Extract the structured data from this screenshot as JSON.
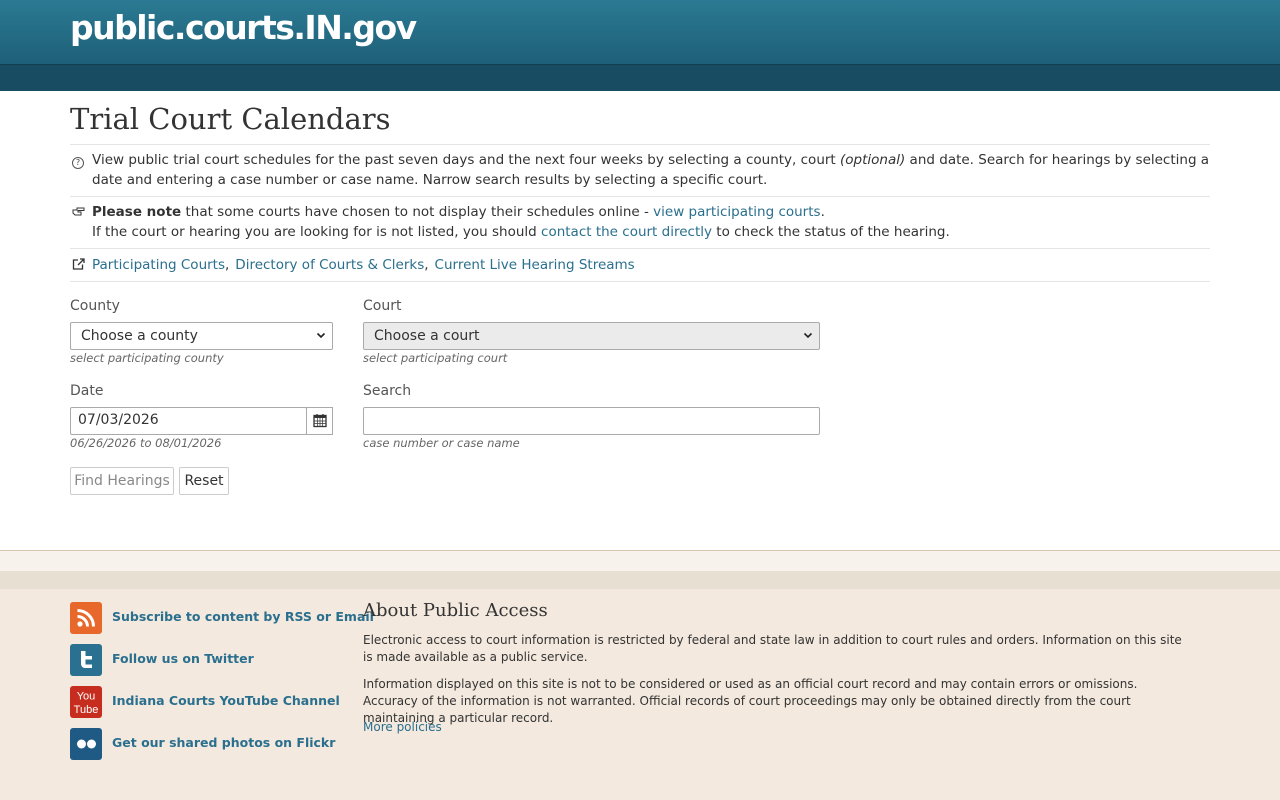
{
  "header": {
    "site_title": "public.courts.IN.gov"
  },
  "page": {
    "title": "Trial Court Calendars"
  },
  "info": {
    "intro_1": "View public trial court schedules for the past seven days and the next four weeks by selecting a county, court ",
    "intro_optional": "(optional)",
    "intro_2": " and date. Search for hearings by selecting a date and entering a case number or case name. Narrow search results by selecting a specific court.",
    "note_bold": "Please note",
    "note_1": " that some courts have chosen to not display their schedules online - ",
    "note_link": "view participating courts",
    "note_end": ".",
    "note_2": "If the court or hearing you are looking for is not listed, you should ",
    "note_link2": "contact the court directly",
    "note_3": " to check the status of the hearing.",
    "links": [
      "Participating Courts",
      "Directory of Courts & Clerks",
      "Current Live Hearing Streams"
    ],
    "link_sep": ","
  },
  "form": {
    "county_label": "County",
    "county_value": "Choose a county",
    "county_hint": "select participating county",
    "court_label": "Court",
    "court_value": "Choose a court",
    "court_hint": "select participating court",
    "date_label": "Date",
    "date_value": "07/03/2026",
    "date_hint": "06/26/2026 to 08/01/2026",
    "search_label": "Search",
    "search_value": "",
    "search_hint": "case number or case name",
    "find_button": "Find Hearings",
    "reset_button": "Reset"
  },
  "footer": {
    "social": [
      {
        "label": "Subscribe to content by RSS or Email",
        "icon": "rss-icon",
        "color": "#e8682c"
      },
      {
        "label": "Follow us on Twitter",
        "icon": "twitter-icon",
        "color": "#2a7090"
      },
      {
        "label": "Indiana Courts YouTube Channel",
        "icon": "youtube-icon",
        "color": "#c62d1f"
      },
      {
        "label": "Get our shared photos on Flickr",
        "icon": "flickr-icon",
        "color": "#1f5a85"
      }
    ],
    "youtube_text_1": "You",
    "youtube_text_2": "Tube",
    "about_title": "About Public Access",
    "about_p1": "Electronic access to court information is restricted by federal and state law in addition to court rules and orders. Information on this site is made available as a public service.",
    "about_p2": "Information displayed on this site is not to be considered or used as an official court record and may contain errors or omissions. Accuracy of the information is not warranted. Official records of court proceedings may only be obtained directly from the court maintaining a particular record.",
    "more_policies": "More policies"
  }
}
